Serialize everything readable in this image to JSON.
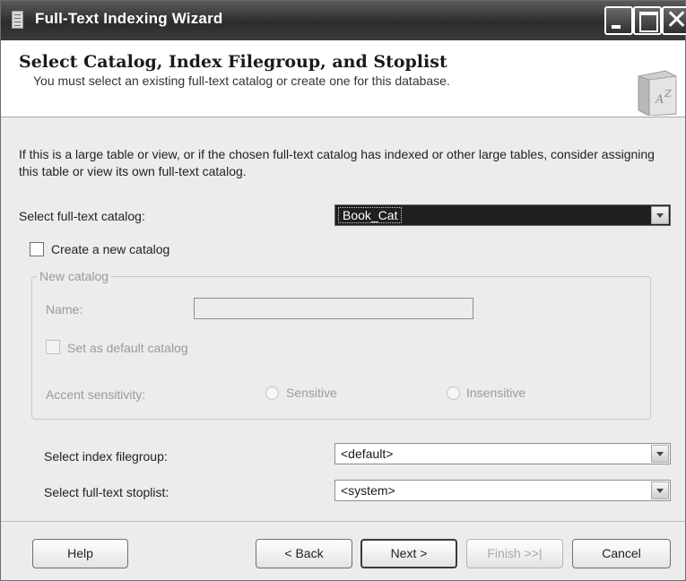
{
  "window": {
    "title": "Full-Text Indexing Wizard"
  },
  "header": {
    "title": "Select Catalog, Index Filegroup, and Stoplist",
    "subtitle": "You must select an existing full-text catalog or create one for this database."
  },
  "intro_text": "If this is a large table or view, or if the chosen full-text catalog has indexed or other large tables, consider assigning this table or view its own full-text catalog.",
  "catalog_select": {
    "label": "Select full-text catalog:",
    "value": "Book_Cat"
  },
  "create_new_catalog": {
    "label": "Create a new catalog",
    "checked": false
  },
  "new_catalog": {
    "legend": "New catalog",
    "name_label": "Name:",
    "name_value": "",
    "default_label": "Set as default catalog",
    "accent_label": "Accent sensitivity:",
    "sensitive_label": "Sensitive",
    "insensitive_label": "Insensitive"
  },
  "filegroup_select": {
    "label": "Select index filegroup:",
    "value": "<default>"
  },
  "stoplist_select": {
    "label": "Select full-text stoplist:",
    "value": "<system>"
  },
  "buttons": {
    "help": "Help",
    "back": "< Back",
    "next": "Next >",
    "finish": "Finish >>|",
    "cancel": "Cancel"
  },
  "icons": {
    "header": "catalog-book-icon",
    "app": "document-icon"
  }
}
